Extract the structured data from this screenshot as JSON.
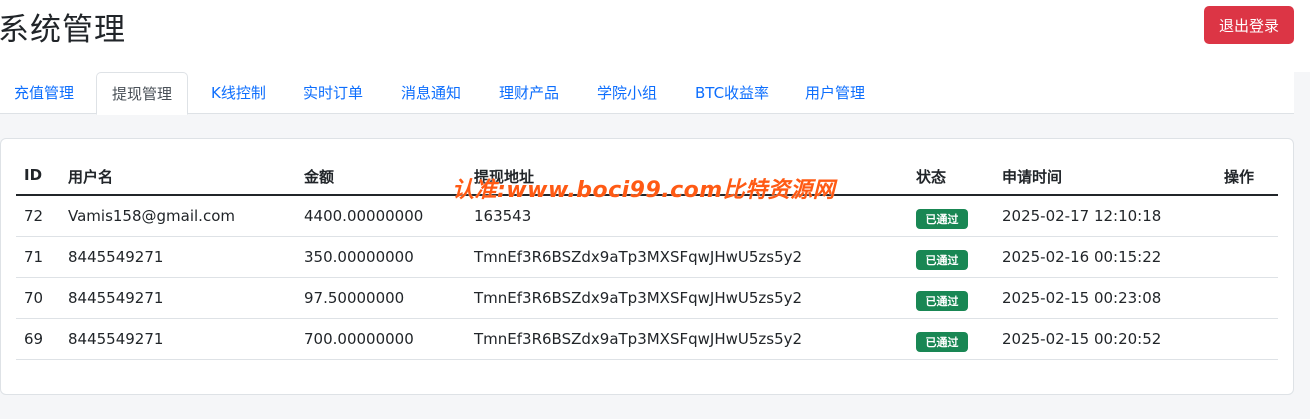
{
  "header": {
    "title": "系统管理",
    "logout_label": "退出登录"
  },
  "tabs": [
    {
      "label": "充值管理",
      "active": false
    },
    {
      "label": "提现管理",
      "active": true
    },
    {
      "label": "K线控制",
      "active": false
    },
    {
      "label": "实时订单",
      "active": false
    },
    {
      "label": "消息通知",
      "active": false
    },
    {
      "label": "理财产品",
      "active": false
    },
    {
      "label": "学院小组",
      "active": false
    },
    {
      "label": "BTC收益率",
      "active": false
    },
    {
      "label": "用户管理",
      "active": false
    }
  ],
  "table": {
    "columns": [
      "ID",
      "用户名",
      "金额",
      "提现地址",
      "状态",
      "申请时间",
      "操作"
    ],
    "rows": [
      {
        "id": "72",
        "user": "Vamis158@gmail.com",
        "amount": "4400.00000000",
        "address": "163543",
        "status": "已通过",
        "time": "2025-02-17 12:10:18"
      },
      {
        "id": "71",
        "user": "8445549271",
        "amount": "350.00000000",
        "address": "TmnEf3R6BSZdx9aTp3MXSFqwJHwU5zs5y2",
        "status": "已通过",
        "time": "2025-02-16 00:15:22"
      },
      {
        "id": "70",
        "user": "8445549271",
        "amount": "97.50000000",
        "address": "TmnEf3R6BSZdx9aTp3MXSFqwJHwU5zs5y2",
        "status": "已通过",
        "time": "2025-02-15 00:23:08"
      },
      {
        "id": "69",
        "user": "8445549271",
        "amount": "700.00000000",
        "address": "TmnEf3R6BSZdx9aTp3MXSFqwJHwU5zs5y2",
        "status": "已通过",
        "time": "2025-02-15 00:20:52"
      }
    ]
  },
  "watermark": "认准:www.boci99.com比特资源网",
  "colors": {
    "danger": "#dc3545",
    "link": "#0d6efd",
    "success": "#198754",
    "watermark": "#ff5a14"
  }
}
